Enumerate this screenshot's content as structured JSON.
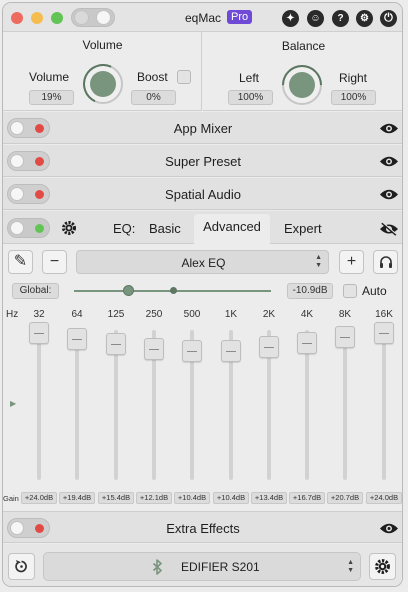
{
  "window": {
    "title": "eqMac",
    "badge": "Pro"
  },
  "volume": {
    "title": "Volume",
    "volume_label": "Volume",
    "volume_value": "19%",
    "volume_level": 0.19,
    "boost_label": "Boost",
    "boost_value": "0%"
  },
  "balance": {
    "title": "Balance",
    "left_label": "Left",
    "left_value": "100%",
    "right_label": "Right",
    "right_value": "100%"
  },
  "sections": {
    "app_mixer": "App Mixer",
    "super_preset": "Super Preset",
    "spatial_audio": "Spatial Audio",
    "extra_effects": "Extra Effects"
  },
  "eq": {
    "label": "EQ:",
    "tabs": [
      "Basic",
      "Advanced",
      "Expert"
    ],
    "active_tab": "Advanced",
    "preset": "Alex EQ",
    "global_label": "Global:",
    "global_value": "-10.9dB",
    "auto_label": "Auto",
    "hz_label": "Hz",
    "gain_label": "Gain",
    "bands": [
      {
        "freq": "32",
        "gain": "+24.0dB",
        "level": 1.0
      },
      {
        "freq": "64",
        "gain": "+19.4dB",
        "level": 0.904
      },
      {
        "freq": "125",
        "gain": "+15.4dB",
        "level": 0.821
      },
      {
        "freq": "250",
        "gain": "+12.1dB",
        "level": 0.752
      },
      {
        "freq": "500",
        "gain": "+10.4dB",
        "level": 0.717
      },
      {
        "freq": "1K",
        "gain": "+10.4dB",
        "level": 0.717
      },
      {
        "freq": "2K",
        "gain": "+13.4dB",
        "level": 0.779
      },
      {
        "freq": "4K",
        "gain": "+16.7dB",
        "level": 0.848
      },
      {
        "freq": "8K",
        "gain": "+20.7dB",
        "level": 0.931
      },
      {
        "freq": "16K",
        "gain": "+24.0dB",
        "level": 1.0
      }
    ]
  },
  "output": {
    "device": "EDIFIER S201"
  },
  "colors": {
    "accent_green": "#79957e",
    "close": "#ee6a5e",
    "minimize": "#f5bd4f",
    "zoom": "#61c454",
    "pro_badge": "#6e4ad6",
    "toggle_off_dot": "#e24a45"
  }
}
